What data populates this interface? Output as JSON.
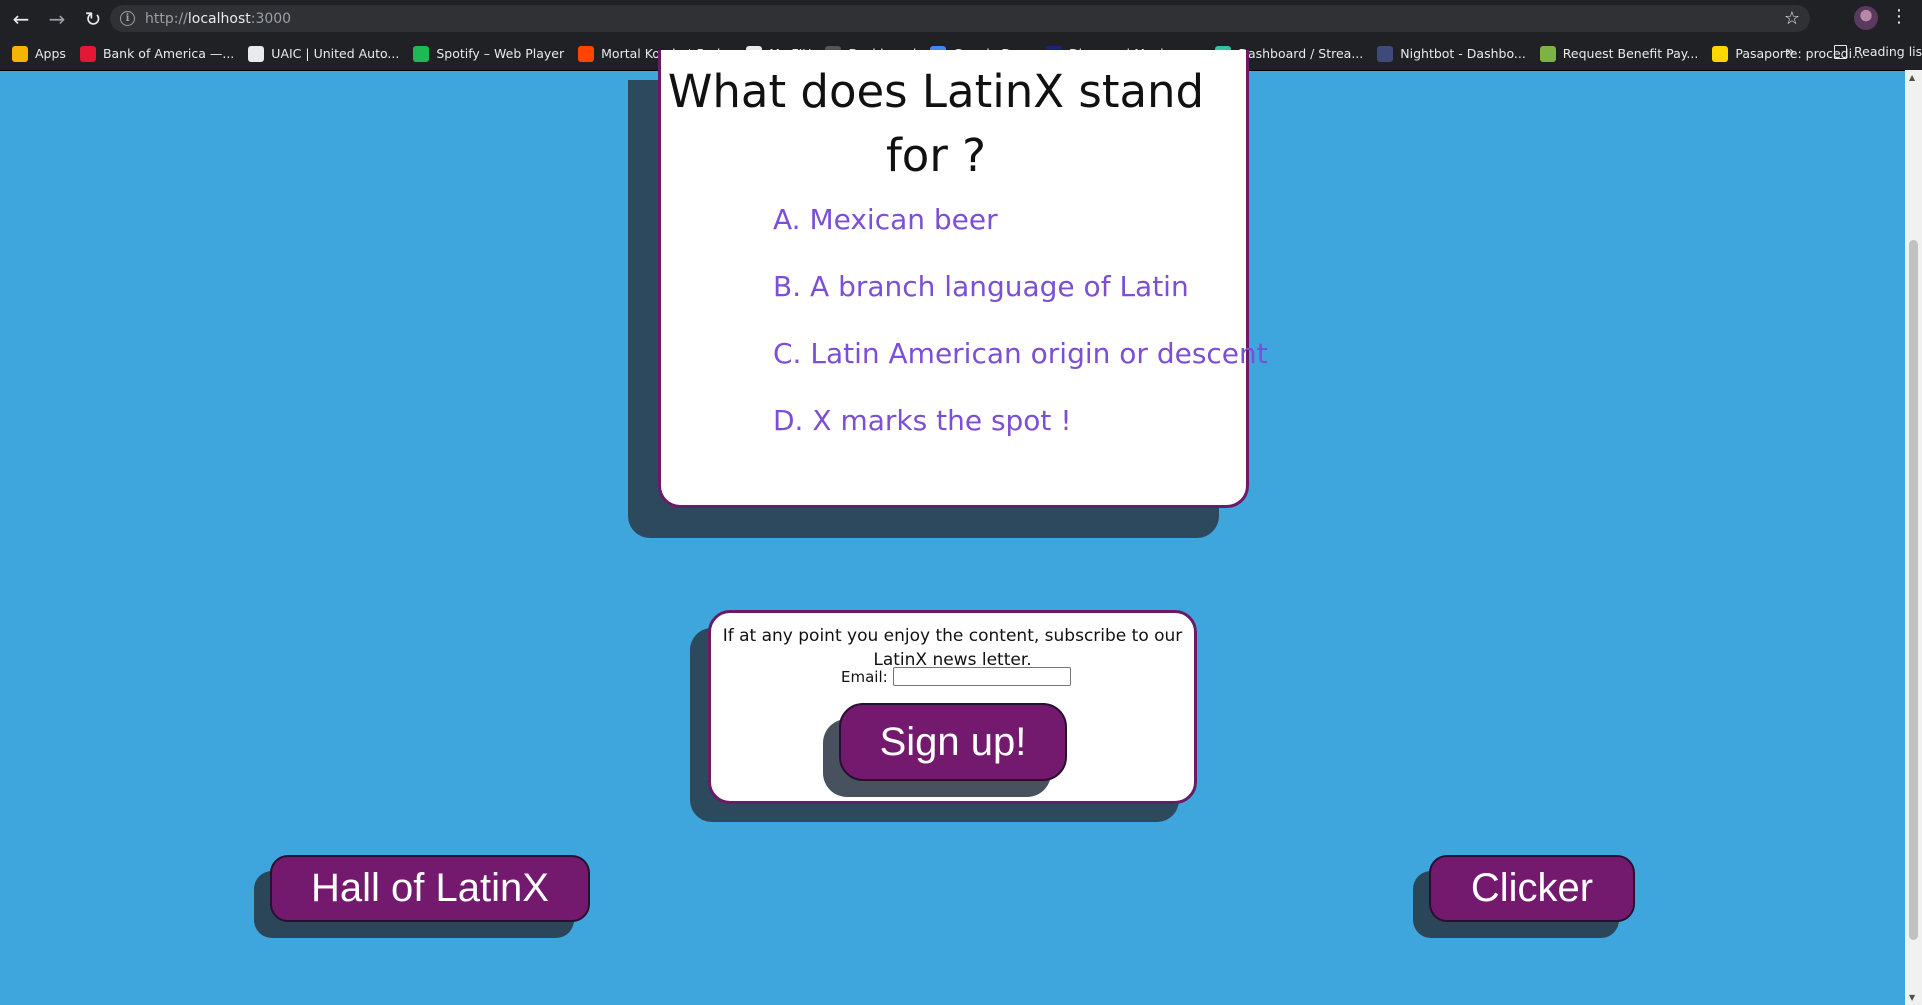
{
  "browser": {
    "url_scheme": "http://",
    "url_host": "localhost",
    "url_port": ":3000",
    "bookmarks": [
      {
        "label": "Apps",
        "icon": "apps-grid-icon",
        "color": "#f4b400"
      },
      {
        "label": "Bank of America —...",
        "icon": "bank-of-america-icon",
        "color": "#e31837"
      },
      {
        "label": "UAIC | United Auto...",
        "icon": "uaic-icon",
        "color": "#e8eaed"
      },
      {
        "label": "Spotify – Web Player",
        "icon": "spotify-icon",
        "color": "#1db954"
      },
      {
        "label": "Mortal Kombat Red...",
        "icon": "reddit-icon",
        "color": "#ff4500"
      },
      {
        "label": "My FIU",
        "icon": "fiu-icon",
        "color": "#e8eaed"
      },
      {
        "label": "Dashboard",
        "icon": "dashboard-icon",
        "color": "#555555"
      },
      {
        "label": "Google Docs",
        "icon": "google-docs-icon",
        "color": "#4285f4"
      },
      {
        "label": "Disney+ | Movies a...",
        "icon": "disney-plus-icon",
        "color": "#1a237e"
      },
      {
        "label": "Dashboard / Strea...",
        "icon": "streamlabs-icon",
        "color": "#31c3a2"
      },
      {
        "label": "Nightbot - Dashbo...",
        "icon": "nightbot-icon",
        "color": "#3d4a7a"
      },
      {
        "label": "Request Benefit Pay...",
        "icon": "benefit-icon",
        "color": "#7cb342"
      },
      {
        "label": "Pasaporte: procedi...",
        "icon": "pasaporte-icon",
        "color": "#ffd600"
      }
    ],
    "more_label": "»",
    "reading_list_label": "Reading list"
  },
  "quiz": {
    "question": "What does LatinX stand for ?",
    "answers": [
      "A. Mexican beer",
      "B. A branch language of Latin",
      "C. Latin American origin or descent",
      "D. X marks the spot !"
    ]
  },
  "newsletter": {
    "text": "If at any point you enjoy the content, subscribe to our LatinX news letter.",
    "email_label": "Email:",
    "email_value": "",
    "signup_label": "Sign up!"
  },
  "nav": {
    "hall_label": "Hall of LatinX",
    "clicker_label": "Clicker"
  },
  "colors": {
    "page_background": "#3ea6dc",
    "card_border": "#6b1b66",
    "button": "#741a6e",
    "answer_text": "#7b4fd6"
  }
}
